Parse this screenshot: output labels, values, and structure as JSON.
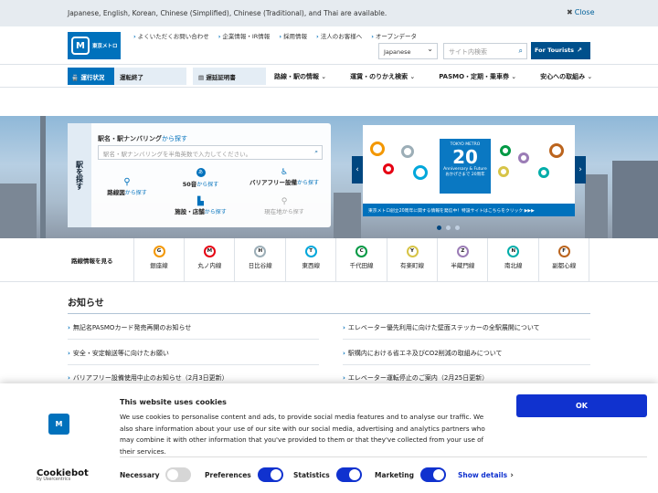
{
  "langbar": {
    "message": "Japanese, English, Korean, Chinese (Simplified), Chinese (Traditional), and Thai are available.",
    "close": "Close"
  },
  "header": {
    "logo_text": "東京メトロ",
    "toplinks": [
      "よくいただくお問い合わせ",
      "企業情報・IR情報",
      "採用情報",
      "法人のお客様へ",
      "オープンデータ"
    ],
    "language": "Japanese",
    "search_placeholder": "サイト内検索",
    "tourists_button": "For Tourists"
  },
  "nav": {
    "status_label": "運行状況",
    "status_value": "運転終了",
    "delay_cert": "遅延証明書",
    "items": [
      "路線・駅の情報",
      "運賃・のりかえ検索",
      "PASMO・定期・乗車券",
      "安心への取組み"
    ]
  },
  "station_search": {
    "side_label": "駅を探す",
    "title": "駅名・駅ナンバリング",
    "title_suffix": "から探す",
    "placeholder": "駅名・駅ナンバリングを半角英数で入力してください。",
    "route_map": "路線図",
    "route_map_suffix": "から探す",
    "kana": "50音",
    "kana_suffix": "から探す",
    "barrier_free": "バリアフリー設備",
    "barrier_free_suffix": "から探す",
    "facilities": "施設・店舗",
    "facilities_suffix": "から探す",
    "current_location": "現在地",
    "current_location_suffix": "から探す"
  },
  "banner": {
    "brand": "TOKYO METRO",
    "number": "20",
    "subtitle": "Anniversary & Future",
    "jp_sub": "おかげさまで 20周年",
    "strip": "東京メトロ創立20周年に関する情報を発信中！特設サイトはこちらをクリック ▶▶▶"
  },
  "lines": {
    "label": "路線情報を見る",
    "items": [
      {
        "code": "G",
        "name": "銀座線",
        "color": "#f39700"
      },
      {
        "code": "M",
        "name": "丸ノ内線",
        "color": "#e60012"
      },
      {
        "code": "H",
        "name": "日比谷線",
        "color": "#9caeb7"
      },
      {
        "code": "T",
        "name": "東西線",
        "color": "#00a7db"
      },
      {
        "code": "C",
        "name": "千代田線",
        "color": "#009944"
      },
      {
        "code": "Y",
        "name": "有楽町線",
        "color": "#d7c447"
      },
      {
        "code": "Z",
        "name": "半蔵門線",
        "color": "#9b7cb6"
      },
      {
        "code": "N",
        "name": "南北線",
        "color": "#00ada9"
      },
      {
        "code": "F",
        "name": "副都心線",
        "color": "#bb641d"
      }
    ]
  },
  "news": {
    "title": "お知らせ",
    "left": [
      "無記名PASMOカード発売再開のお知らせ",
      "安全・安定輸送等に向けたお願い",
      "バリアフリー設備使用中止のお知らせ（2月3日更新）"
    ],
    "right": [
      "エレベーター優先利用に向けた壁面ステッカーの全駅展開について",
      "駅構内における省エネ及びCO2削減の取組みについて",
      "エレベーター運転停止のご案内（2月25日更新）"
    ]
  },
  "cookie": {
    "title": "This website uses cookies",
    "text": "We use cookies to personalise content and ads, to provide social media features and to analyse our traffic. We also share information about your use of our site with our social media, advertising and analytics partners who may combine it with other information that you've provided to them or that they've collected from your use of their services.",
    "ok": "OK",
    "brand": "Cookiebot",
    "brand_sub": "by Usercentrics",
    "toggles": [
      {
        "label": "Necessary",
        "on": false
      },
      {
        "label": "Preferences",
        "on": true
      },
      {
        "label": "Statistics",
        "on": true
      },
      {
        "label": "Marketing",
        "on": true
      }
    ],
    "show_details": "Show details"
  }
}
